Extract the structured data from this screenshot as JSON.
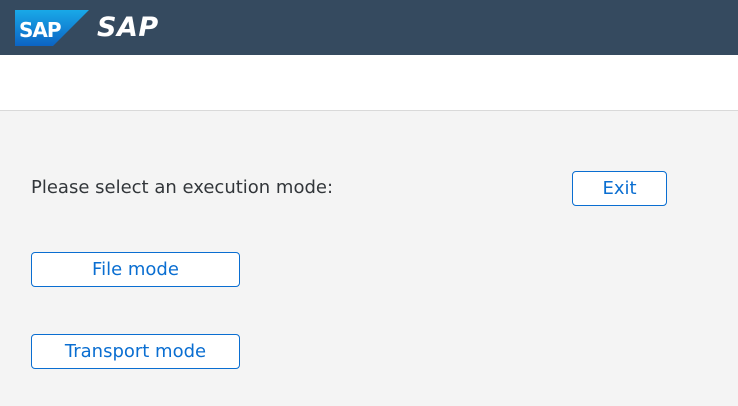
{
  "header": {
    "logo_text": "SAP",
    "title": "SAP"
  },
  "content": {
    "prompt": "Please select an execution mode:",
    "exit_label": "Exit",
    "file_mode_label": "File mode",
    "transport_mode_label": "Transport mode"
  },
  "colors": {
    "shell_background": "#354a5f",
    "logo_blue": "#0a6ed1",
    "button_text": "#0a6ed1",
    "page_background": "#f4f4f4"
  }
}
